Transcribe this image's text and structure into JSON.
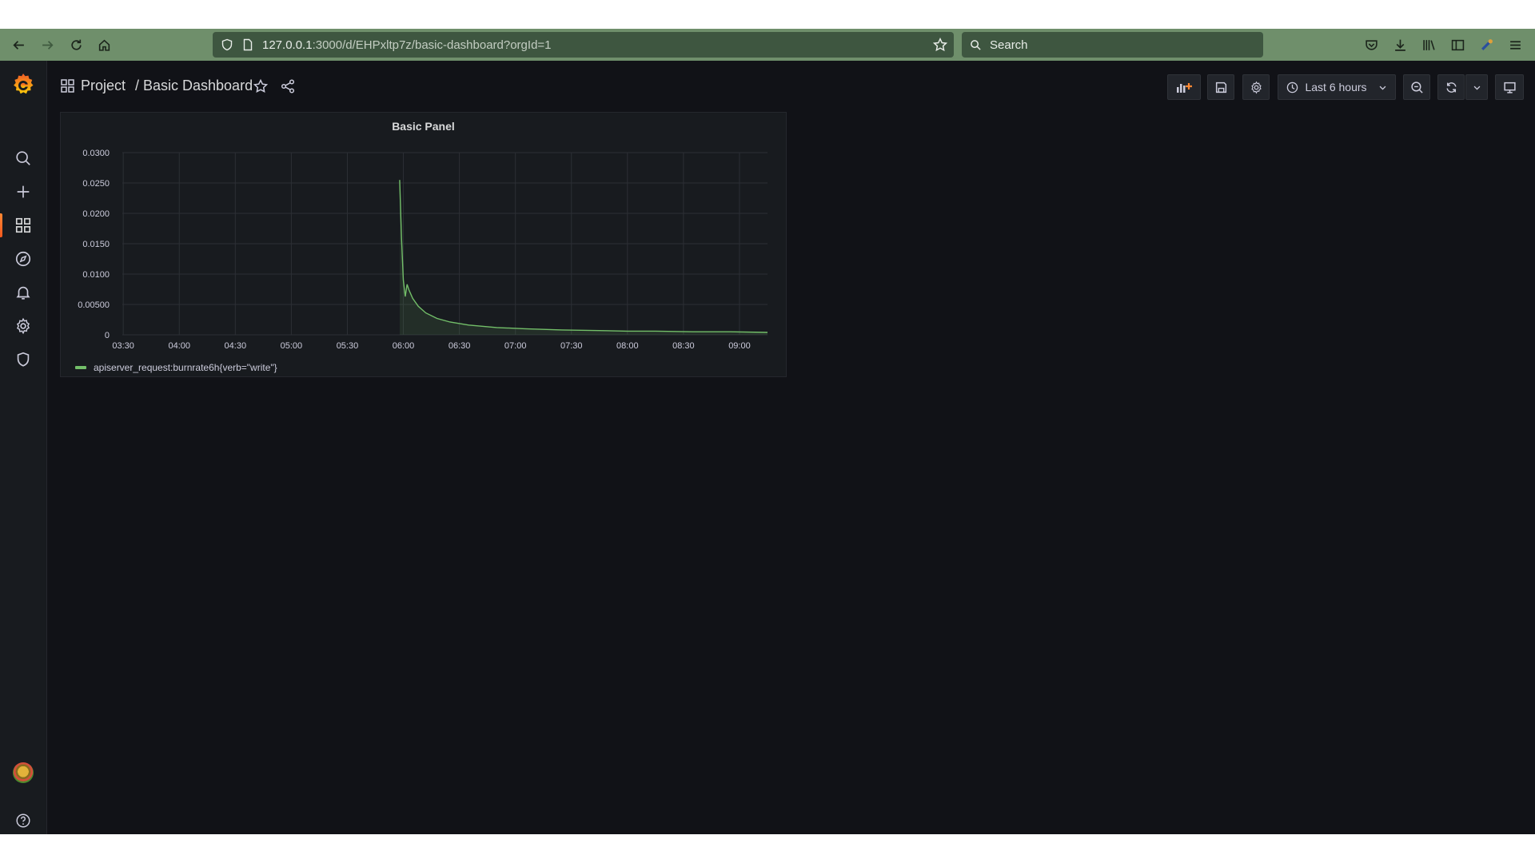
{
  "browser": {
    "url_host": "127.0.0.1",
    "url_path": ":3000/d/EHPxltp7z/basic-dashboard?orgId=1",
    "search_placeholder": "Search",
    "toolbar_color": "#6f8f6b",
    "icons": [
      "back-icon",
      "forward-icon",
      "reload-icon",
      "home-icon",
      "shield-icon",
      "page-icon",
      "bookmark-star-icon",
      "search-icon",
      "pocket-icon",
      "download-icon",
      "library-icon",
      "sidebar-icon",
      "extension-icon",
      "menu-icon"
    ]
  },
  "sidemenu": {
    "items": [
      "search",
      "create",
      "dashboards",
      "explore",
      "alerting",
      "configuration",
      "server-admin"
    ],
    "bottom": [
      "profile-avatar",
      "help"
    ],
    "accent": "#f5581e"
  },
  "navbar": {
    "folder": "Project",
    "separator": "/",
    "title": "Basic Dashboard",
    "time_range": "Last 6 hours",
    "buttons": [
      "add-panel",
      "save-dashboard",
      "dashboard-settings",
      "time-picker",
      "zoom-out",
      "refresh",
      "refresh-interval",
      "cycle-view-mode"
    ]
  },
  "panel": {
    "title": "Basic Panel",
    "chart_data": {
      "type": "line",
      "title": "Basic Panel",
      "xlabel": "",
      "ylabel": "",
      "x_tick_labels": [
        "03:30",
        "04:00",
        "04:30",
        "05:00",
        "05:30",
        "06:00",
        "06:30",
        "07:00",
        "07:30",
        "08:00",
        "08:30",
        "09:00"
      ],
      "y_tick_labels": [
        "0",
        "0.00500",
        "0.0100",
        "0.0150",
        "0.0200",
        "0.0250",
        "0.0300"
      ],
      "ylim": [
        0,
        0.03
      ],
      "xlim": [
        "03:30",
        "09:15"
      ],
      "grid": true,
      "legend_position": "bottom-left",
      "series": [
        {
          "name": "apiserver_request:burnrate6h{verb=\"write\"}",
          "color": "#73bf69",
          "fill": true,
          "points": [
            {
              "x": "05:58",
              "y": 0.0255
            },
            {
              "x": "05:59",
              "y": 0.016
            },
            {
              "x": "06:00",
              "y": 0.009
            },
            {
              "x": "06:01",
              "y": 0.0063
            },
            {
              "x": "06:02",
              "y": 0.0083
            },
            {
              "x": "06:03",
              "y": 0.0074
            },
            {
              "x": "06:05",
              "y": 0.006
            },
            {
              "x": "06:08",
              "y": 0.0047
            },
            {
              "x": "06:12",
              "y": 0.0036
            },
            {
              "x": "06:18",
              "y": 0.0027
            },
            {
              "x": "06:25",
              "y": 0.0021
            },
            {
              "x": "06:35",
              "y": 0.0016
            },
            {
              "x": "06:50",
              "y": 0.0012
            },
            {
              "x": "07:05",
              "y": 0.001
            },
            {
              "x": "07:25",
              "y": 0.0008
            },
            {
              "x": "07:45",
              "y": 0.0007
            },
            {
              "x": "08:00",
              "y": 0.0006
            },
            {
              "x": "08:15",
              "y": 0.0006
            },
            {
              "x": "08:35",
              "y": 0.0005
            },
            {
              "x": "08:55",
              "y": 0.0005
            },
            {
              "x": "09:15",
              "y": 0.0004
            }
          ]
        }
      ]
    }
  }
}
